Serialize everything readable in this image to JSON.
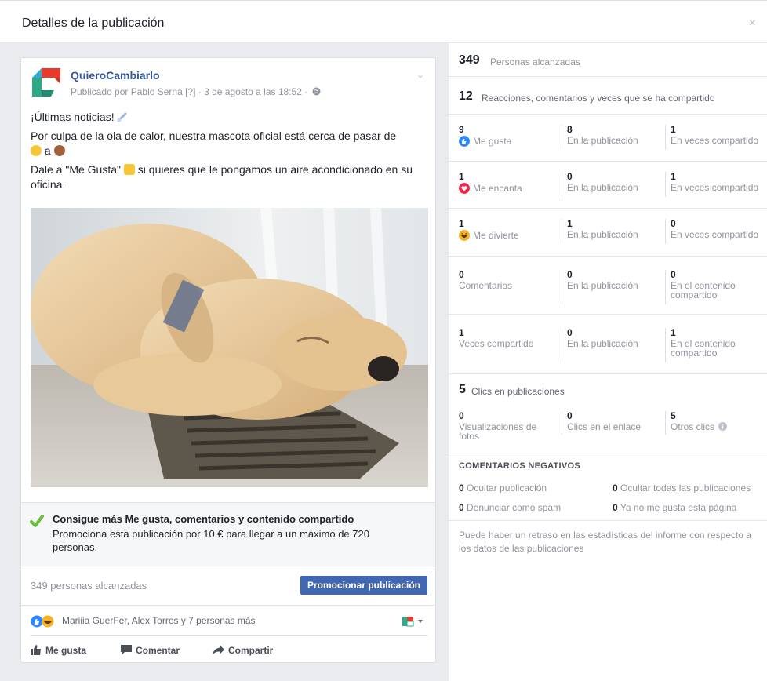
{
  "dialog": {
    "title": "Detalles de la publicación",
    "close": "×"
  },
  "post": {
    "page_name": "QuieroCambiarlo",
    "meta": "Publicado por Pablo Serna [?] · 3 de agosto a las 18:52 ·",
    "line1": "¡Últimas noticias!",
    "line2a": "Por culpa de la ola de calor, nuestra mascota oficial está cerca de pasar de",
    "line2b": "a",
    "line3a": "Dale a \"Me Gusta\"",
    "line3b": "si quieres que le pongamos un aire acondicionado en su oficina."
  },
  "promo": {
    "title": "Consigue más Me gusta, comentarios y contenido compartido",
    "desc": "Promociona esta publicación por 10 € para llegar a un máximo de 720 personas."
  },
  "reach_row": {
    "text": "349 personas alcanzadas",
    "button": "Promocionar publicación"
  },
  "reactions_row": {
    "names": "Mariiia GuerFer, Alex Torres y 7 personas más"
  },
  "actions": {
    "like": "Me gusta",
    "comment": "Comentar",
    "share": "Compartir"
  },
  "stats": {
    "reach_num": "349",
    "reach_label": "Personas alcanzadas",
    "engagement_num": "12",
    "engagement_label": "Reacciones, comentarios y veces que se ha compartido",
    "rows": [
      {
        "c1n": "9",
        "c1l": "Me gusta",
        "c2n": "8",
        "c2l": "En la publicación",
        "c3n": "1",
        "c3l": "En veces compartido"
      },
      {
        "c1n": "1",
        "c1l": "Me encanta",
        "c2n": "0",
        "c2l": "En la publicación",
        "c3n": "1",
        "c3l": "En veces compartido"
      },
      {
        "c1n": "1",
        "c1l": "Me divierte",
        "c2n": "1",
        "c2l": "En la publicación",
        "c3n": "0",
        "c3l": "En veces compartido"
      },
      {
        "c1n": "0",
        "c1l": "Comentarios",
        "c2n": "0",
        "c2l": "En la publicación",
        "c3n": "0",
        "c3l": "En el contenido compartido"
      },
      {
        "c1n": "1",
        "c1l": "Veces compartido",
        "c2n": "0",
        "c2l": "En la publicación",
        "c3n": "1",
        "c3l": "En el contenido compartido"
      }
    ],
    "clicks_num": "5",
    "clicks_label": "Clics en publicaciones",
    "clicks": [
      {
        "n": "0",
        "l": "Visualizaciones de fotos"
      },
      {
        "n": "0",
        "l": "Clics en el enlace"
      },
      {
        "n": "5",
        "l": "Otros clics"
      }
    ],
    "negative_title": "COMENTARIOS NEGATIVOS",
    "negative": [
      {
        "n": "0",
        "l": "Ocultar publicación"
      },
      {
        "n": "0",
        "l": "Ocultar todas las publicaciones"
      },
      {
        "n": "0",
        "l": "Denunciar como spam"
      },
      {
        "n": "0",
        "l": "Ya no me gusta esta página"
      }
    ],
    "note": "Puede haber un retraso en las estadísticas del informe con respecto a los datos de las publicaciones"
  },
  "colors": {
    "link": "#365899",
    "button": "#4267b2",
    "muted": "#90949c",
    "like": "#2d88ff",
    "love": "#f0284a",
    "haha": "#f7b125",
    "check": "#6bbe3a"
  }
}
